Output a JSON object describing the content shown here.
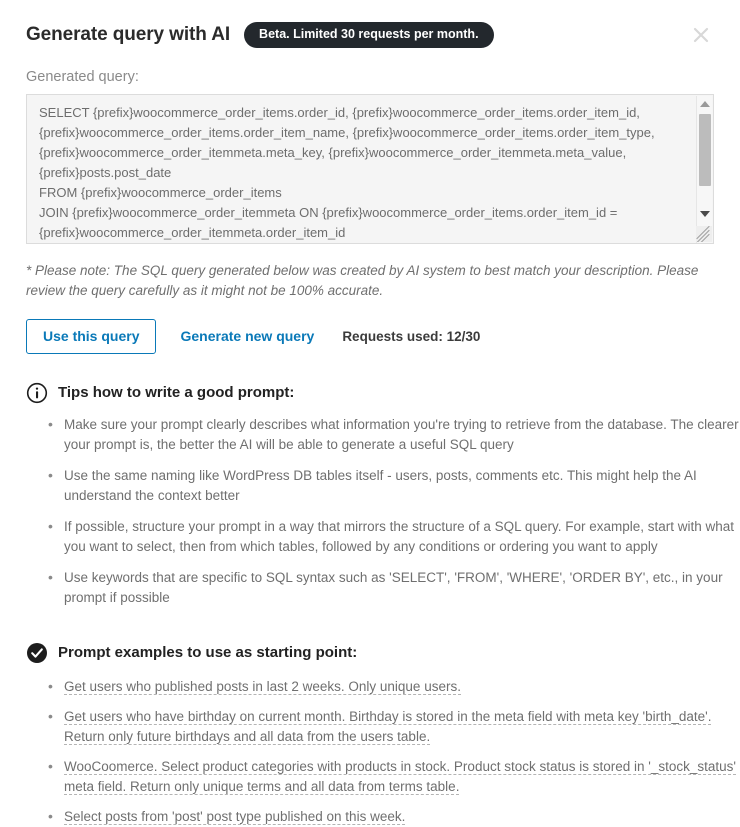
{
  "header": {
    "title": "Generate query with AI",
    "badge": "Beta. Limited 30 requests per month.",
    "close_icon": "close-icon"
  },
  "query_field": {
    "label": "Generated query:",
    "value": "SELECT {prefix}woocommerce_order_items.order_id, {prefix}woocommerce_order_items.order_item_id, {prefix}woocommerce_order_items.order_item_name, {prefix}woocommerce_order_items.order_item_type, {prefix}woocommerce_order_itemmeta.meta_key, {prefix}woocommerce_order_itemmeta.meta_value, {prefix}posts.post_date\nFROM {prefix}woocommerce_order_items\nJOIN {prefix}woocommerce_order_itemmeta ON {prefix}woocommerce_order_items.order_item_id = {prefix}woocommerce_order_itemmeta.order_item_id\nJOIN {prefix}posts ON {prefix}woocommerce_order_items.order_id = {prefix}posts.ID"
  },
  "note": "* Please note: The SQL query generated below was created by AI system to best match your description. Please review the query carefully as it might not be 100% accurate.",
  "actions": {
    "use_query_label": "Use this query",
    "generate_new_label": "Generate new query",
    "requests_used": "Requests used: 12/30",
    "accent_color": "#0a79b8"
  },
  "tips_section": {
    "icon": "info-circle-icon",
    "title": "Tips how to write a good prompt:",
    "items": [
      "Make sure your prompt clearly describes what information you're trying to retrieve from the database. The clearer your prompt is, the better the AI will be able to generate a useful SQL query",
      "Use the same naming like WordPress DB tables itself - users, posts, comments etc. This might help the AI understand the context better",
      "If possible, structure your prompt in a way that mirrors the structure of a SQL query. For example, start with what you want to select, then from which tables, followed by any conditions or ordering you want to apply",
      "Use keywords that are specific to SQL syntax such as 'SELECT', 'FROM', 'WHERE', 'ORDER BY', etc., in your prompt if possible"
    ]
  },
  "examples_section": {
    "icon": "check-circle-icon",
    "title": "Prompt examples to use as starting point:",
    "items": [
      "Get users who published posts in last 2 weeks. Only unique users.",
      "Get users who have birthday on current month. Birthday is stored in the meta field with meta key 'birth_date'. Return only future birthdays and all data from the users table.",
      "WooCoomerce. Select product categories with products in stock. Product stock status is stored in '_stock_status' meta field. Return only unique terms and all data from terms table.",
      "Select posts from 'post' post type published on this week."
    ]
  }
}
